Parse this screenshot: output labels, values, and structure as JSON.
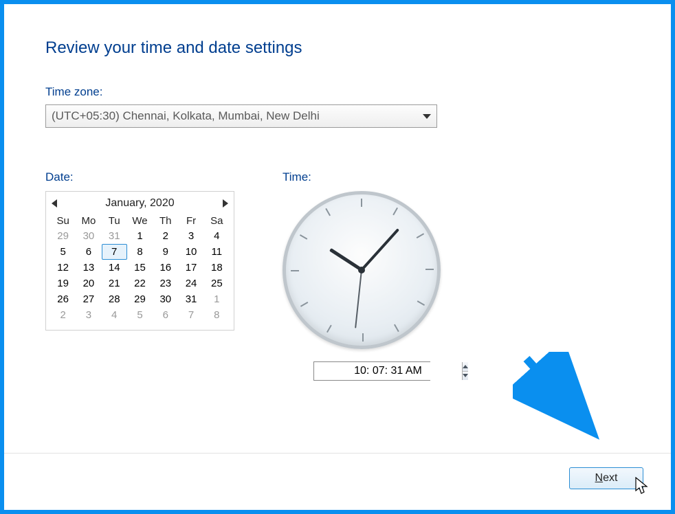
{
  "page": {
    "title": "Review your time and date settings"
  },
  "timezone": {
    "label": "Time zone:",
    "selected": "(UTC+05:30) Chennai, Kolkata, Mumbai, New Delhi"
  },
  "date": {
    "label": "Date:",
    "month_title": "January, 2020",
    "dow": [
      "Su",
      "Mo",
      "Tu",
      "We",
      "Th",
      "Fr",
      "Sa"
    ],
    "weeks": [
      [
        {
          "n": "29",
          "out": true
        },
        {
          "n": "30",
          "out": true
        },
        {
          "n": "31",
          "out": true
        },
        {
          "n": "1"
        },
        {
          "n": "2"
        },
        {
          "n": "3"
        },
        {
          "n": "4"
        }
      ],
      [
        {
          "n": "5"
        },
        {
          "n": "6"
        },
        {
          "n": "7",
          "sel": true
        },
        {
          "n": "8"
        },
        {
          "n": "9"
        },
        {
          "n": "10"
        },
        {
          "n": "11"
        }
      ],
      [
        {
          "n": "12"
        },
        {
          "n": "13"
        },
        {
          "n": "14"
        },
        {
          "n": "15"
        },
        {
          "n": "16"
        },
        {
          "n": "17"
        },
        {
          "n": "18"
        }
      ],
      [
        {
          "n": "19"
        },
        {
          "n": "20"
        },
        {
          "n": "21"
        },
        {
          "n": "22"
        },
        {
          "n": "23"
        },
        {
          "n": "24"
        },
        {
          "n": "25"
        }
      ],
      [
        {
          "n": "26"
        },
        {
          "n": "27"
        },
        {
          "n": "28"
        },
        {
          "n": "29"
        },
        {
          "n": "30"
        },
        {
          "n": "31"
        },
        {
          "n": "1",
          "out": true
        }
      ],
      [
        {
          "n": "2",
          "out": true
        },
        {
          "n": "3",
          "out": true
        },
        {
          "n": "4",
          "out": true
        },
        {
          "n": "5",
          "out": true
        },
        {
          "n": "6",
          "out": true
        },
        {
          "n": "7",
          "out": true
        },
        {
          "n": "8",
          "out": true
        }
      ]
    ]
  },
  "time": {
    "label": "Time:",
    "value": "10: 07: 31 AM",
    "hour_angle": 303,
    "minute_angle": 42,
    "second_angle": 186
  },
  "footer": {
    "next_prefix": "N",
    "next_rest": "ext"
  }
}
